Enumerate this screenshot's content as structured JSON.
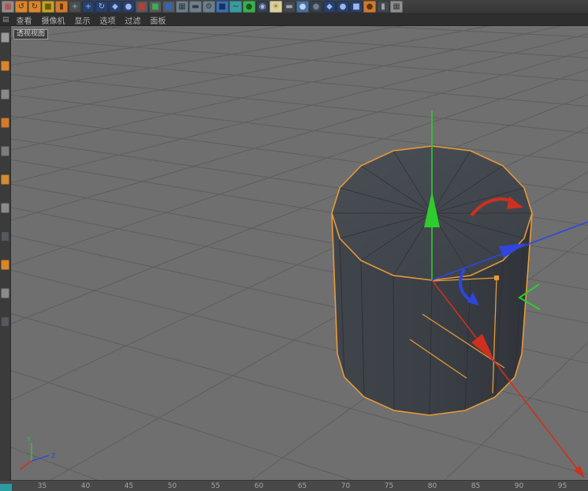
{
  "viewport_menu": {
    "panel_icon": "▤",
    "items": [
      "查看",
      "摄像机",
      "显示",
      "选项",
      "过滤",
      "面板"
    ]
  },
  "viewport_label": "透视视图",
  "toolbar": {
    "icons": [
      {
        "name": "layout-palette-icon",
        "color": "#8f8f8f",
        "glyph": "▦",
        "glyph_color": "#c23b2e"
      },
      {
        "name": "undo-icon",
        "color": "#d9862f",
        "glyph": "↺",
        "glyph_color": "#4a2c08"
      },
      {
        "name": "redo-icon",
        "color": "#d9862f",
        "glyph": "↻",
        "glyph_color": "#4a2c08"
      },
      {
        "name": "modeling-cube-icon",
        "color": "#bfa32e",
        "glyph": "■",
        "glyph_color": "#6e5c10"
      },
      {
        "name": "extrude-cylinder-icon",
        "color": "#cf7a2e",
        "glyph": "▮",
        "glyph_color": "#5c350e"
      },
      {
        "name": "axis-tool-icon",
        "color": "#4c4c4c",
        "glyph": "+",
        "glyph_color": "#58c8d8"
      },
      {
        "name": "move-tool-icon",
        "color": "#27406e",
        "glyph": "+",
        "glyph_color": "#9db8e8"
      },
      {
        "name": "rotate-tool-icon",
        "color": "#27406e",
        "glyph": "↻",
        "glyph_color": "#9db8e8"
      },
      {
        "name": "scale-tool-icon",
        "color": "#27406e",
        "glyph": "◆",
        "glyph_color": "#9db8e8"
      },
      {
        "name": "coordinate-system-icon",
        "color": "#27406e",
        "glyph": "●",
        "glyph_color": "#9db8e8"
      },
      {
        "name": "x-axis-lock-icon",
        "color": "#565b61",
        "glyph": "■",
        "glyph_color": "#c23b2e"
      },
      {
        "name": "y-axis-lock-icon",
        "color": "#565b61",
        "glyph": "■",
        "glyph_color": "#3fae4f"
      },
      {
        "name": "z-axis-lock-icon",
        "color": "#565b61",
        "glyph": "■",
        "glyph_color": "#2e66c2"
      },
      {
        "name": "render-view-icon",
        "color": "#6e7e8a",
        "glyph": "▦",
        "glyph_color": "#2e3a44"
      },
      {
        "name": "render-to-picture-icon",
        "color": "#6e7e8a",
        "glyph": "▬",
        "glyph_color": "#2e3a44"
      },
      {
        "name": "render-settings-icon",
        "color": "#6e7e8a",
        "glyph": "⚙",
        "glyph_color": "#2e3a44"
      },
      {
        "name": "primitive-cube-icon",
        "color": "#3f6fb5",
        "glyph": "■",
        "glyph_color": "#16325e"
      },
      {
        "name": "spline-pen-icon",
        "color": "#3a9aa0",
        "glyph": "~",
        "glyph_color": "#0e3c40"
      },
      {
        "name": "sphere-object-icon",
        "color": "#3fae4f",
        "glyph": "●",
        "glyph_color": "#145c1e"
      },
      {
        "name": "camera-object-icon",
        "color": "#36414e",
        "glyph": "◉",
        "glyph_color": "#9db8e8"
      },
      {
        "name": "light-object-icon",
        "color": "#d8d0a0",
        "glyph": "☀",
        "glyph_color": "#b07818"
      },
      {
        "name": "floor-object-icon",
        "color": "#44484e",
        "glyph": "▬",
        "glyph_color": "#9aa4ae"
      },
      {
        "name": "sky-object-icon",
        "color": "#4a6f9e",
        "glyph": "●",
        "glyph_color": "#bcd4ee"
      },
      {
        "name": "material-icon",
        "color": "#36414e",
        "glyph": "●",
        "glyph_color": "#6e7e8a"
      },
      {
        "name": "mograph-icon",
        "color": "#27406e",
        "glyph": "◆",
        "glyph_color": "#9db8e8"
      },
      {
        "name": "simulation-icon",
        "color": "#27406e",
        "glyph": "●",
        "glyph_color": "#9db8e8"
      },
      {
        "name": "volume-icon",
        "color": "#27406e",
        "glyph": "■",
        "glyph_color": "#9db8e8"
      },
      {
        "name": "character-tool-icon",
        "color": "#cf7a2e",
        "glyph": "●",
        "glyph_color": "#5c350e"
      },
      {
        "name": "timeline-track-icon",
        "color": "#44484e",
        "glyph": "▮",
        "glyph_color": "#9aa4ae"
      },
      {
        "name": "display-filter-icon",
        "color": "#8f8f8f",
        "glyph": "▦",
        "glyph_color": "#3a3a3a"
      }
    ]
  },
  "sidebar": {
    "icons": [
      {
        "name": "live-selection-icon",
        "color": "#9a9a9a"
      },
      {
        "name": "pen-tool-icon",
        "color": "#d9862f"
      },
      {
        "name": "measure-tool-icon",
        "color": "#8a8a8a"
      },
      {
        "name": "magnet-snap-icon",
        "color": "#cf7a2e"
      },
      {
        "name": "mirror-tool-icon",
        "color": "#7c7c7c"
      },
      {
        "name": "brush-tool-icon",
        "color": "#d08a3a"
      },
      {
        "name": "knife-tool-icon",
        "color": "#8a8a8a"
      },
      {
        "name": "smooth-shift-icon",
        "color": "#55585c"
      },
      {
        "name": "arc-tool-icon",
        "color": "#d9862f"
      },
      {
        "name": "grid-snap-icon",
        "color": "#8a8a8a"
      },
      {
        "name": "workplane-icon",
        "color": "#55585c"
      }
    ]
  },
  "timeline": {
    "ticks": [
      "35",
      "40",
      "45",
      "50",
      "55",
      "60",
      "65",
      "70",
      "75",
      "80",
      "85",
      "90",
      "95"
    ],
    "marker_color": "#2e9aa2"
  },
  "axis_indicator": {
    "y_label": "Y",
    "z_label": "Z"
  },
  "gizmo": {
    "x_color": "#cf2f1f",
    "y_color": "#2ecc2e",
    "z_color": "#2f46dd",
    "selection_color": "#e79a3a"
  }
}
